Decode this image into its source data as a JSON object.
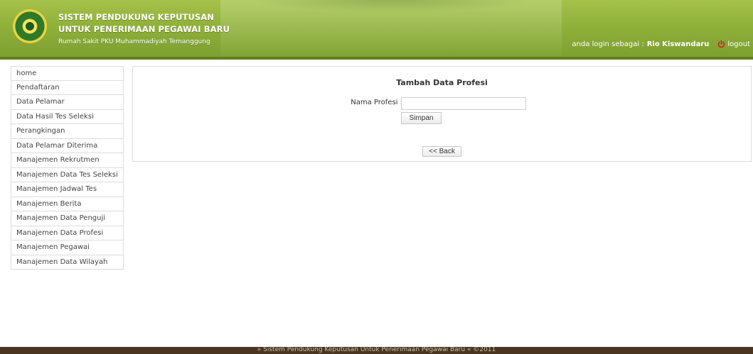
{
  "header": {
    "title_line1": "SISTEM PENDUKUNG KEPUTUSAN",
    "title_line2": "UNTUK PENERIMAAN PEGAWAI BARU",
    "subtitle": "Rumah Sakit PKU Muhammadiyah Temanggung",
    "login_prefix": "anda login sebagai :",
    "username": "Rio Kiswandaru",
    "logout_label": "logout",
    "logo_icon": "hospital-logo-icon",
    "power_icon": "power-icon",
    "accent_color": "#8fb03a"
  },
  "sidebar": {
    "items": [
      {
        "label": "home"
      },
      {
        "label": "Pendaftaran"
      },
      {
        "label": "Data Pelamar"
      },
      {
        "label": "Data Hasil Tes Seleksi"
      },
      {
        "label": "Perangkingan"
      },
      {
        "label": "Data Pelamar Diterima"
      },
      {
        "label": "Manajemen Rekrutmen"
      },
      {
        "label": "Manajemen Data Tes Seleksi"
      },
      {
        "label": "Manajemen Jadwal Tes"
      },
      {
        "label": "Manajemen Berita"
      },
      {
        "label": "Manajemen Data Penguji"
      },
      {
        "label": "Manajemen Data Profesi"
      },
      {
        "label": "Manajemen Pegawai"
      },
      {
        "label": "Manajemen Data Wilayah"
      }
    ]
  },
  "form": {
    "title": "Tambah Data Profesi",
    "field_label": "Nama Profesi :",
    "field_value": "",
    "save_label": "Simpan",
    "back_label": "<< Back"
  },
  "footer": {
    "text": "» Sistem Pendukung Keputusan Untuk Penerimaan Pegawai Baru «  ©2011",
    "background": "#4a3520"
  }
}
